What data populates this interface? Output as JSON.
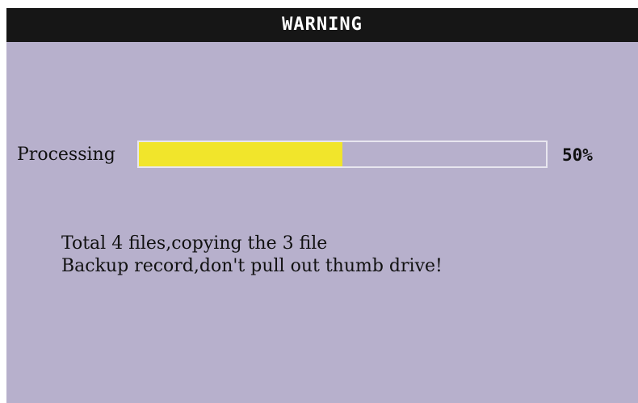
{
  "dialog": {
    "title": "WARNING"
  },
  "progress": {
    "label": "Processing",
    "percent_text": "50%",
    "value": 0.5,
    "colors": {
      "fill": "#f1e52b",
      "track_border": "#e8e6ef"
    }
  },
  "message": {
    "line1": "Total 4 files,copying the 3 file",
    "line2": "Backup record,don't pull out thumb drive!"
  },
  "colors": {
    "background": "#b7b0cc",
    "titlebar": "#161616",
    "title_text": "#ffffff"
  }
}
